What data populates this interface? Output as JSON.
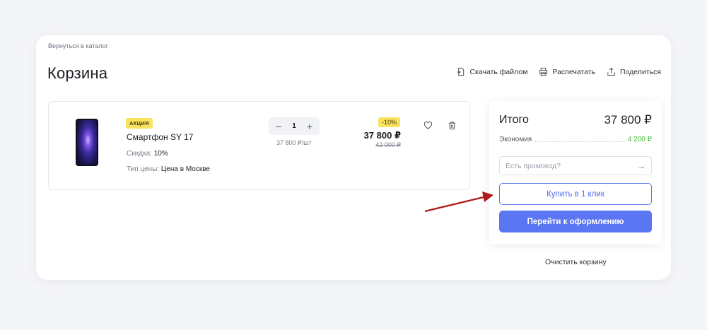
{
  "breadcrumb": {
    "back_label": "Вернуться в каталог"
  },
  "page": {
    "title": "Корзина"
  },
  "header_actions": [
    {
      "icon": "download-file-icon",
      "label": "Скачать файлом"
    },
    {
      "icon": "printer-icon",
      "label": "Распечатать"
    },
    {
      "icon": "share-icon",
      "label": "Поделиться"
    }
  ],
  "cart_item": {
    "badge": "АКЦИЯ",
    "name": "Смартфон SY 17",
    "discount_label": "Скидка:",
    "discount_value": "10%",
    "price_type_label": "Тип цены:",
    "price_type_value": "Цена в Москве",
    "quantity": "1",
    "minus_symbol": "−",
    "plus_symbol": "+",
    "unit_price": "37 800 ₽/шт",
    "discount_badge": "-10%",
    "price": "37 800 ₽",
    "old_price": "42 000 ₽"
  },
  "summary": {
    "total_label": "Итого",
    "total_value": "37 800 ₽",
    "savings_label": "Экономия",
    "savings_value": "4 200 ₽",
    "promo_placeholder": "Есть промокод?",
    "promo_arrow": "→",
    "one_click_label": "Купить в 1 клик",
    "checkout_label": "Перейти к оформлению"
  },
  "clear_cart_label": "Очистить корзину",
  "colors": {
    "accent": "#5b76f2",
    "badge_yellow": "#f9e25c",
    "savings_green": "#3fbf3a",
    "annotation_red": "#b01818"
  }
}
